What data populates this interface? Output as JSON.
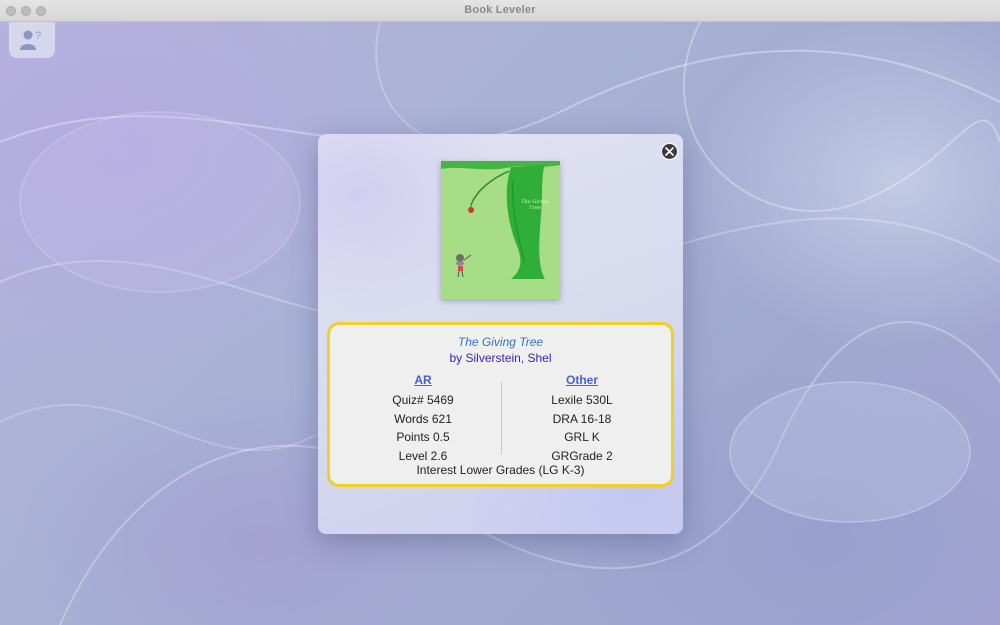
{
  "window": {
    "title": "Book Leveler"
  },
  "toolbar": {
    "help_icon": "person-question-icon"
  },
  "book": {
    "title": "The Giving Tree",
    "author": "by Silverstein, Shel",
    "cover_text": "The Giving Tree"
  },
  "ar": {
    "heading": "AR",
    "rows": [
      "Quiz# 5469",
      "Words 621",
      "Points 0.5",
      "Level 2.6"
    ]
  },
  "other": {
    "heading": "Other",
    "rows": [
      "Lexile 530L",
      "DRA 16-18",
      "GRL K",
      "GRGrade 2"
    ]
  },
  "interest": "Interest Lower Grades (LG K-3)",
  "colors": {
    "card_border": "#f2cf25",
    "title_color": "#2f74c9",
    "author_color": "#3a23b5",
    "heading_color": "#4b5fd6",
    "cover_background": "#a7dd86"
  }
}
